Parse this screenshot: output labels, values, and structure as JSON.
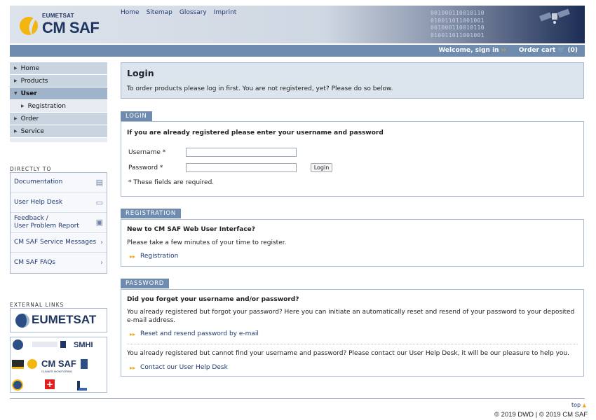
{
  "header": {
    "logo_small": "EUMETSAT",
    "logo_big": "CM SAF",
    "nav": [
      "Home",
      "Sitemap",
      "Glossary",
      "Imprint"
    ],
    "binary": [
      "001000110010110",
      "010011011001001",
      "001000110010110",
      "010011011001001"
    ]
  },
  "statusbar": {
    "welcome": "Welcome, sign in",
    "cart_label": "Order cart",
    "cart_count": "(0)"
  },
  "sidebar": {
    "items": [
      {
        "label": "Home"
      },
      {
        "label": "Products"
      },
      {
        "label": "User"
      },
      {
        "label": "Registration"
      },
      {
        "label": "Order"
      },
      {
        "label": "Service"
      }
    ],
    "directly_to_heading": "DIRECTLY TO",
    "directly_to": [
      {
        "label": "Documentation",
        "icon": "document-icon"
      },
      {
        "label": "User Help Desk",
        "icon": "archive-box-icon"
      },
      {
        "label": "Feedback /",
        "label2": "User Problem Report",
        "icon": "feedback-icon"
      },
      {
        "label": "CM SAF Service Messages",
        "icon": "chevron-right-icon"
      },
      {
        "label": "CM SAF FAQs",
        "icon": "chevron-right-icon"
      }
    ],
    "external_links_heading": "EXTERNAL LINKS",
    "eumetsat_logo": "EUMETSAT",
    "partners": {
      "cmsaf": "CM SAF",
      "smhi": "SMHI",
      "climate": "CLIMATE MONITORING"
    }
  },
  "main": {
    "login_title": "Login",
    "login_info": "To order products please log in first. You are not registered, yet? Please do so below.",
    "login_tab": "LOGIN",
    "login_heading": "If you are already registered please enter your username and password",
    "username_label": "Username *",
    "password_label": "Password *",
    "login_button": "Login",
    "required_note": "* These fields are required.",
    "registration_tab": "REGISTRATION",
    "registration_heading": "New to CM SAF Web User Interface?",
    "registration_text": "Please take a few minutes of your time to register.",
    "registration_link": "Registration",
    "password_tab": "PASSWORD",
    "password_heading": "Did you forget your username and/or password?",
    "password_text1": "You already registered but forgot your password? Here you can initiate an automatically reset and resend of your password to your deposited e-mail address.",
    "password_link1": "Reset and resend password by e-mail",
    "password_text2": "You already registered but cannot find your username and password? Please contact our User Help Desk, it will be our pleasure to help you.",
    "password_link2": "Contact our User Help Desk"
  },
  "footer": {
    "top_link": "top",
    "copyright": "© 2019 DWD | © 2019 CM SAF"
  },
  "colors": {
    "accent_bar": "#6f8bad",
    "arrow_orange": "#f3a51a",
    "link_blue": "#1f3a73"
  }
}
